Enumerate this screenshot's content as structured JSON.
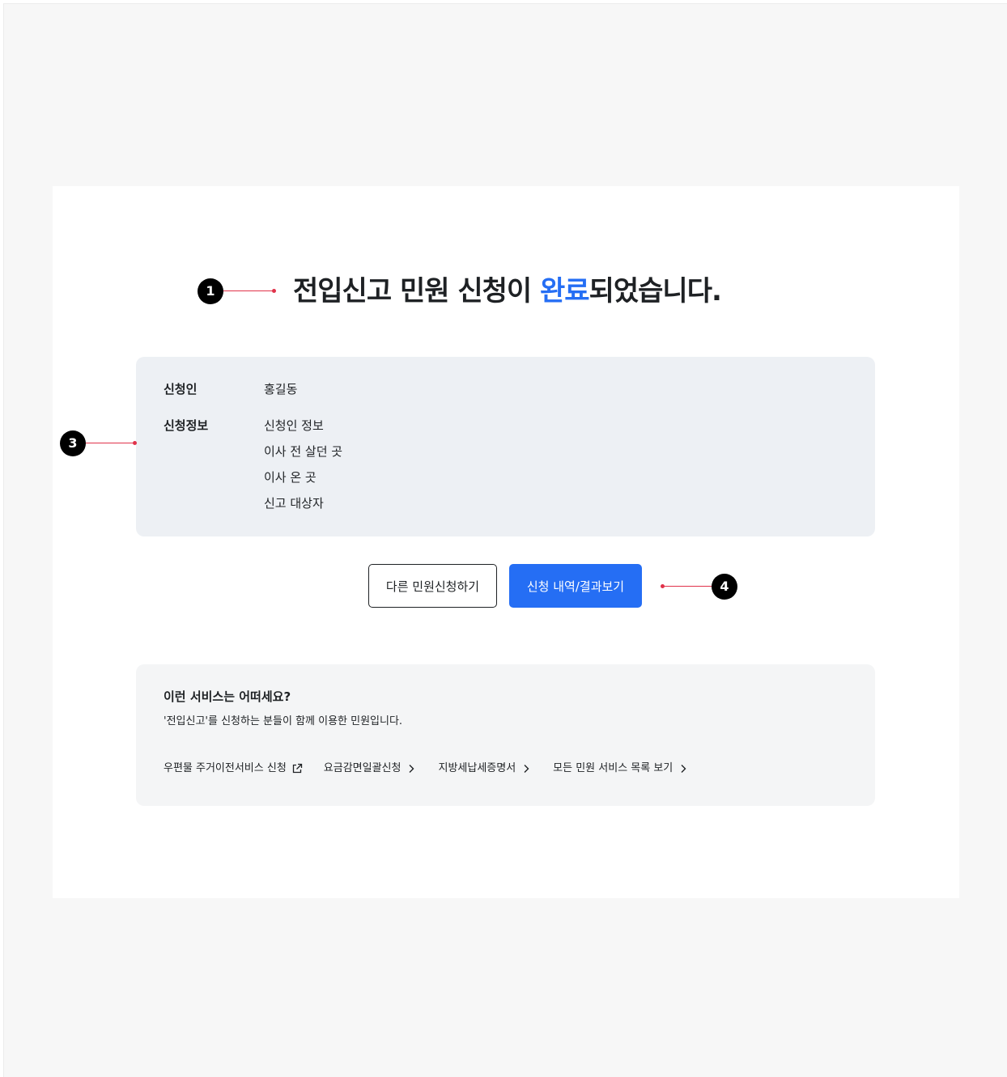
{
  "heading": {
    "prefix": "전입신고 민원 신청이 ",
    "highlight": "완료",
    "suffix": "되었습니다."
  },
  "markers": {
    "title": "1",
    "info": "3",
    "actions": "4"
  },
  "applicant": {
    "label": "신청인",
    "value": "홍길동"
  },
  "application_info": {
    "label": "신청정보",
    "items": [
      "신청인 정보",
      "이사 전 살던 곳",
      "이사 온 곳",
      "신고 대상자"
    ]
  },
  "buttons": {
    "other_application": "다른 민원신청하기",
    "view_history": "신청 내역/결과보기"
  },
  "related": {
    "title": "이런 서비스는 어떠세요?",
    "description": "'전입신고'를 신청하는 분들이 함께 이용한 민원입니다.",
    "links": [
      {
        "label": "우편물 주거이전서비스 신청",
        "icon": "external-link-icon"
      },
      {
        "label": "요금감면일괄신청",
        "icon": "chevron-right-icon"
      },
      {
        "label": "지방세납세증명서",
        "icon": "chevron-right-icon"
      },
      {
        "label": "모든 민원 서비스 목록 보기",
        "icon": "chevron-right-icon"
      }
    ]
  },
  "colors": {
    "accent": "#256ef4",
    "info_background": "#edf0f4",
    "related_background": "#f4f5f6",
    "annotation": "#e0324a"
  }
}
